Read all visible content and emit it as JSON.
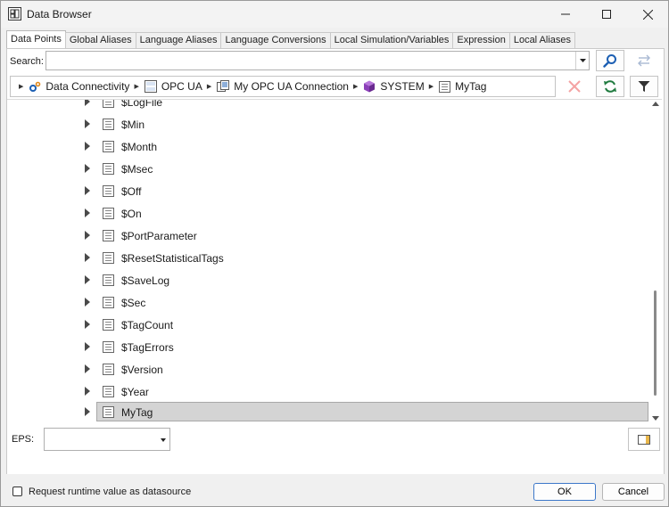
{
  "window": {
    "title": "Data Browser",
    "app_icon": "data-browser-icon"
  },
  "tabs": [
    {
      "label": "Data Points",
      "active": true
    },
    {
      "label": "Global Aliases",
      "active": false
    },
    {
      "label": "Language Aliases",
      "active": false
    },
    {
      "label": "Language Conversions",
      "active": false
    },
    {
      "label": "Local Simulation/Variables",
      "active": false
    },
    {
      "label": "Expression",
      "active": false
    },
    {
      "label": "Local Aliases",
      "active": false
    }
  ],
  "search": {
    "label": "Search:",
    "value": ""
  },
  "breadcrumb": [
    {
      "label": "Data Connectivity",
      "icon": "gears-icon"
    },
    {
      "label": "OPC UA",
      "icon": "opc-ua-icon"
    },
    {
      "label": "My OPC UA Connection",
      "icon": "connection-icon"
    },
    {
      "label": "SYSTEM",
      "icon": "cube-icon"
    },
    {
      "label": "MyTag",
      "icon": "tag-icon"
    }
  ],
  "tree": {
    "items": [
      {
        "label": "$LogFile"
      },
      {
        "label": "$Min"
      },
      {
        "label": "$Month"
      },
      {
        "label": "$Msec"
      },
      {
        "label": "$Off"
      },
      {
        "label": "$On"
      },
      {
        "label": "$PortParameter"
      },
      {
        "label": "$ResetStatisticalTags"
      },
      {
        "label": "$SaveLog"
      },
      {
        "label": "$Sec"
      },
      {
        "label": "$TagCount"
      },
      {
        "label": "$TagErrors"
      },
      {
        "label": "$Version"
      },
      {
        "label": "$Year"
      },
      {
        "label": "MyTag",
        "selected": true
      }
    ]
  },
  "eps": {
    "label": "EPS:",
    "value": ""
  },
  "footer": {
    "checkbox_label": "Request runtime value as datasource",
    "checkbox_checked": false,
    "ok_label": "OK",
    "cancel_label": "Cancel"
  },
  "colors": {
    "accent": "#1c5fb3",
    "refresh": "#1f7a3e",
    "selection": "#d4d4d4",
    "cube": "#8b3fb8"
  }
}
